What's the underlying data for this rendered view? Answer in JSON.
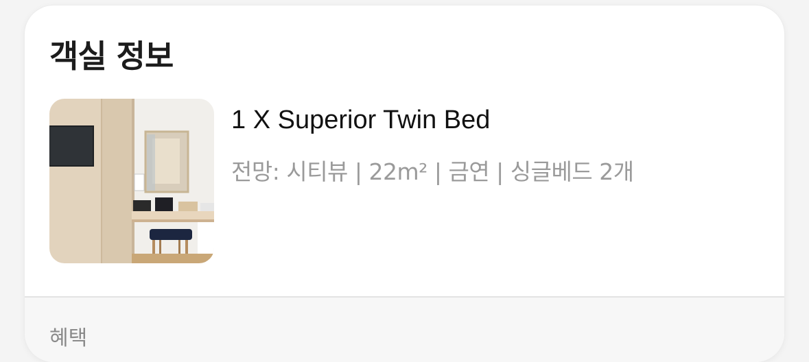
{
  "room_info": {
    "title": "객실 정보",
    "room": {
      "name": "1 X Superior Twin Bed",
      "details": "전망: 시티뷰 | 22m² | 금연 | 싱글베드 2개",
      "photo_icon": "room-photo"
    }
  },
  "benefits": {
    "heading": "혜택"
  }
}
